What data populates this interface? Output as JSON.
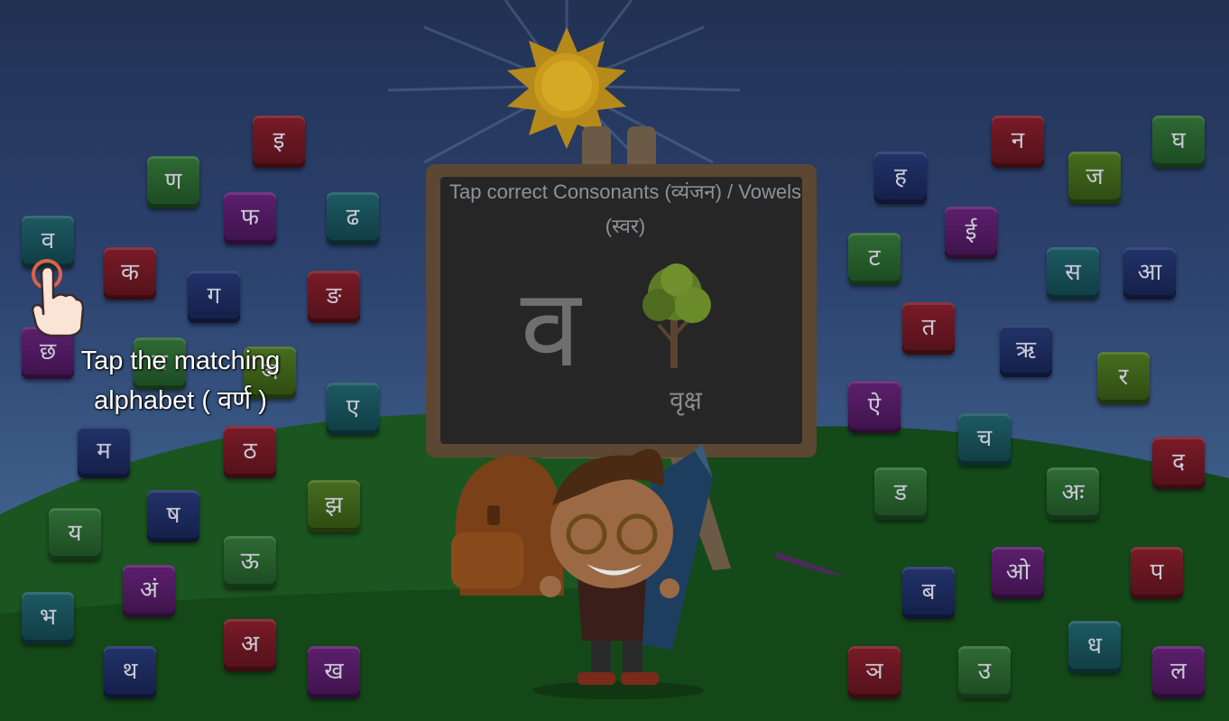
{
  "board": {
    "title": "Tap correct Consonants (व्यंजन) / Vowels (स्वर)",
    "letter": "व",
    "word": "वृक्ष",
    "picture": "tree-icon"
  },
  "hint": {
    "text": "Tap the matching alphabet ( वर्ण )",
    "icon": "pointing-hand-icon"
  },
  "colors": {
    "green": "#2f6b34",
    "red": "#7a1b28",
    "navy": "#22336a",
    "purple": "#5d1f6e",
    "teal": "#1d5a63",
    "olive": "#466d1e"
  },
  "tiles": [
    {
      "letter": "इ",
      "color": "red"
    },
    {
      "letter": "ण",
      "color": "green"
    },
    {
      "letter": "फ",
      "color": "purple"
    },
    {
      "letter": "ढ",
      "color": "teal"
    },
    {
      "letter": "व",
      "color": "teal"
    },
    {
      "letter": "क",
      "color": "red"
    },
    {
      "letter": "ग",
      "color": "navy"
    },
    {
      "letter": "ङ",
      "color": "red"
    },
    {
      "letter": "छ",
      "color": "purple"
    },
    {
      "letter": "ल",
      "color": "green"
    },
    {
      "letter": "ञ",
      "color": "olive"
    },
    {
      "letter": "ए",
      "color": "teal"
    },
    {
      "letter": "म",
      "color": "navy"
    },
    {
      "letter": "ठ",
      "color": "red"
    },
    {
      "letter": "झ",
      "color": "olive"
    },
    {
      "letter": "य",
      "color": "green"
    },
    {
      "letter": "ष",
      "color": "navy"
    },
    {
      "letter": "ऊ",
      "color": "green"
    },
    {
      "letter": "अं",
      "color": "purple"
    },
    {
      "letter": "भ",
      "color": "teal"
    },
    {
      "letter": "अ",
      "color": "red"
    },
    {
      "letter": "थ",
      "color": "navy"
    },
    {
      "letter": "ख",
      "color": "purple"
    },
    {
      "letter": "न",
      "color": "red"
    },
    {
      "letter": "घ",
      "color": "green"
    },
    {
      "letter": "ह",
      "color": "navy"
    },
    {
      "letter": "ज",
      "color": "olive"
    },
    {
      "letter": "ई",
      "color": "purple"
    },
    {
      "letter": "ट",
      "color": "green"
    },
    {
      "letter": "स",
      "color": "teal"
    },
    {
      "letter": "आ",
      "color": "navy"
    },
    {
      "letter": "त",
      "color": "red"
    },
    {
      "letter": "ऋ",
      "color": "navy"
    },
    {
      "letter": "र",
      "color": "olive"
    },
    {
      "letter": "ऐ",
      "color": "purple"
    },
    {
      "letter": "च",
      "color": "teal"
    },
    {
      "letter": "द",
      "color": "red"
    },
    {
      "letter": "ड",
      "color": "green"
    },
    {
      "letter": "अः",
      "color": "green"
    },
    {
      "letter": "ओ",
      "color": "purple"
    },
    {
      "letter": "प",
      "color": "red"
    },
    {
      "letter": "ब",
      "color": "navy"
    },
    {
      "letter": "ध",
      "color": "teal"
    },
    {
      "letter": "ञ",
      "color": "red"
    },
    {
      "letter": "उ",
      "color": "green"
    },
    {
      "letter": "ल",
      "color": "purple"
    }
  ]
}
